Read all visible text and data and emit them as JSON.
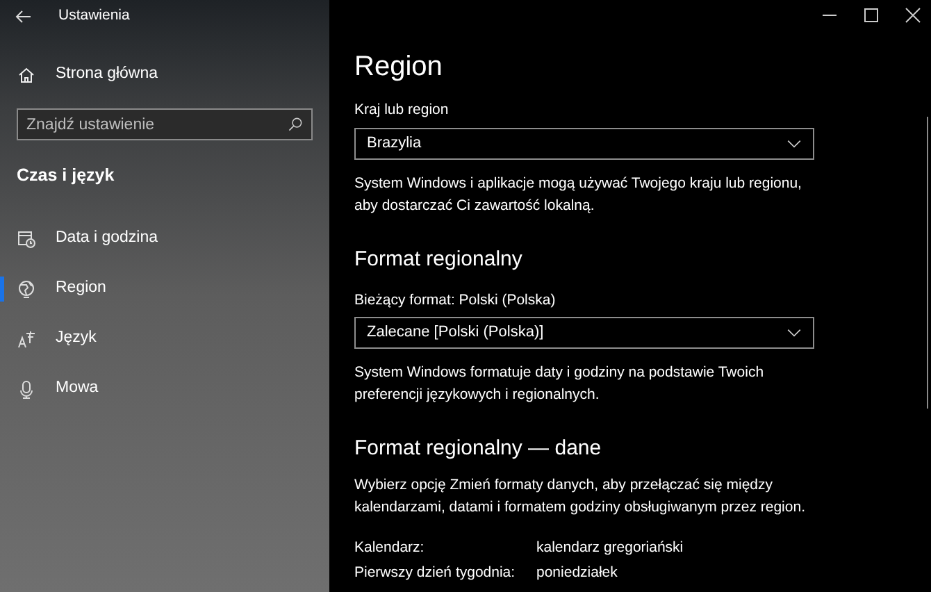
{
  "window": {
    "title": "Ustawienia"
  },
  "sidebar": {
    "home": "Strona główna",
    "search": {
      "placeholder": "Znajdź ustawienie"
    },
    "section": "Czas i język",
    "items": [
      {
        "label": "Data i godzina",
        "selected": false
      },
      {
        "label": "Region",
        "selected": true
      },
      {
        "label": "Język",
        "selected": false
      },
      {
        "label": "Mowa",
        "selected": false
      }
    ]
  },
  "page": {
    "title": "Region",
    "country": {
      "label": "Kraj lub region",
      "value": "Brazylia",
      "description": "System Windows i aplikacje mogą używać Twojego kraju lub regionu, aby dostarczać Ci zawartość lokalną."
    },
    "format": {
      "heading": "Format regionalny",
      "label": "Bieżący format: Polski (Polska)",
      "value": "Zalecane [Polski (Polska)]",
      "description": "System Windows formatuje daty i godziny na podstawie Twoich preferencji językowych i regionalnych."
    },
    "data": {
      "heading": "Format regionalny — dane",
      "description": "Wybierz opcję Zmień formaty danych, aby przełączać się między kalendarzami, datami i formatem godziny obsługiwanym przez region.",
      "rows": [
        {
          "key": "Kalendarz:",
          "value": "kalendarz gregoriański"
        },
        {
          "key": "Pierwszy dzień tygodnia:",
          "value": "poniedziałek"
        }
      ]
    }
  }
}
